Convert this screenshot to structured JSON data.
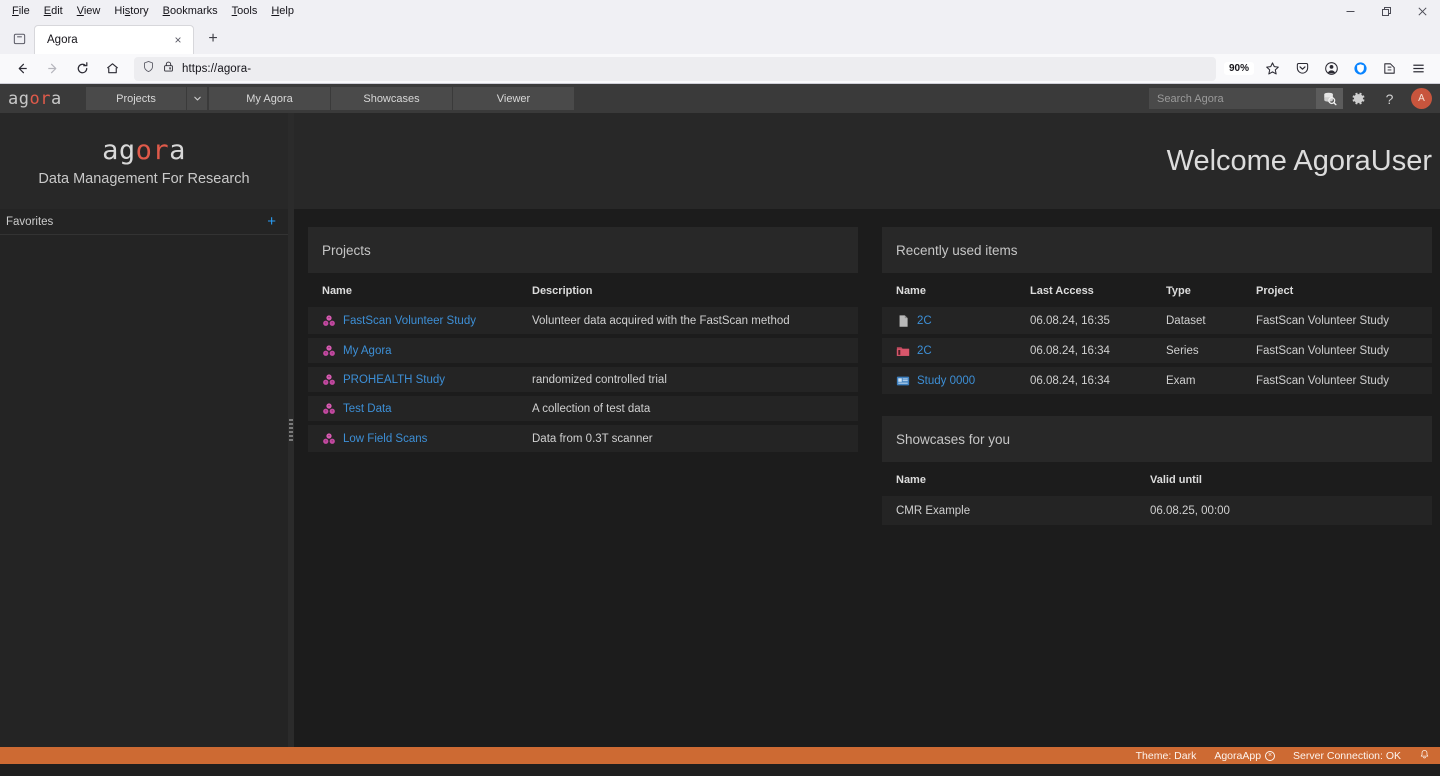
{
  "browser": {
    "menus": [
      "File",
      "Edit",
      "View",
      "History",
      "Bookmarks",
      "Tools",
      "Help"
    ],
    "window_controls": [
      "minimize-button",
      "restore-button",
      "close-button"
    ],
    "tab": {
      "title": "Agora",
      "close_label": "×"
    },
    "new_tab_label": "+",
    "url": "https://agora-",
    "zoom_level": "90%",
    "nav": {
      "back": "back-button",
      "forward": "forward-button",
      "reload": "reload-button",
      "home": "home-button"
    },
    "toolbar_icons": [
      "pocket-icon",
      "account-icon",
      "shield-icon",
      "extensions-icon",
      "menu-icon"
    ]
  },
  "app": {
    "brand": {
      "pre": "ag",
      "hl": "or",
      "post": "a"
    },
    "tabs": [
      {
        "label": "Projects",
        "has_caret": true
      },
      {
        "label": "My Agora",
        "has_caret": false
      },
      {
        "label": "Showcases",
        "has_caret": false
      },
      {
        "label": "Viewer",
        "has_caret": false
      }
    ],
    "search": {
      "placeholder": "Search Agora",
      "value": ""
    },
    "header_actions": {
      "settings": "⚙",
      "help": "?"
    },
    "avatar_initial": "A",
    "accent_red": "#e05a4a",
    "accent_blue": "#3d8fd6",
    "accent_orange": "#cd6a33"
  },
  "sidebar": {
    "logo": {
      "pre": "ag",
      "hl": "or",
      "post": "a"
    },
    "tagline": "Data Management For Research",
    "favorites": {
      "label": "Favorites",
      "add_label": "+"
    }
  },
  "main": {
    "welcome": "Welcome AgoraUser"
  },
  "projects_panel": {
    "title": "Projects",
    "columns": [
      "Name",
      "Description"
    ],
    "rows": [
      {
        "name": "FastScan Volunteer Study",
        "description": "Volunteer data acquired with the FastScan method"
      },
      {
        "name": "My Agora",
        "description": ""
      },
      {
        "name": "PROHEALTH Study",
        "description": "randomized controlled trial"
      },
      {
        "name": "Test Data",
        "description": "A collection of test data"
      },
      {
        "name": "Low Field Scans",
        "description": "Data from 0.3T scanner"
      }
    ]
  },
  "recent_panel": {
    "title": "Recently used items",
    "columns": [
      "Name",
      "Last Access",
      "Type",
      "Project"
    ],
    "rows": [
      {
        "icon": "dataset-file-icon",
        "name": "2C",
        "last_access": "06.08.24, 16:35",
        "type": "Dataset",
        "project": "FastScan Volunteer Study"
      },
      {
        "icon": "series-folder-icon",
        "name": "2C",
        "last_access": "06.08.24, 16:34",
        "type": "Series",
        "project": "FastScan Volunteer Study"
      },
      {
        "icon": "exam-card-icon",
        "name": "Study 0000",
        "last_access": "06.08.24, 16:34",
        "type": "Exam",
        "project": "FastScan Volunteer Study"
      }
    ]
  },
  "showcases_panel": {
    "title": "Showcases for you",
    "columns": [
      "Name",
      "Valid until"
    ],
    "rows": [
      {
        "name": "CMR Example",
        "valid_until": "06.08.25, 00:00"
      }
    ]
  },
  "statusbar": {
    "theme": "Theme: Dark",
    "app_name": "AgoraApp",
    "app_close_glyph": "×",
    "connection": "Server Connection: OK",
    "bell": "🔔"
  }
}
